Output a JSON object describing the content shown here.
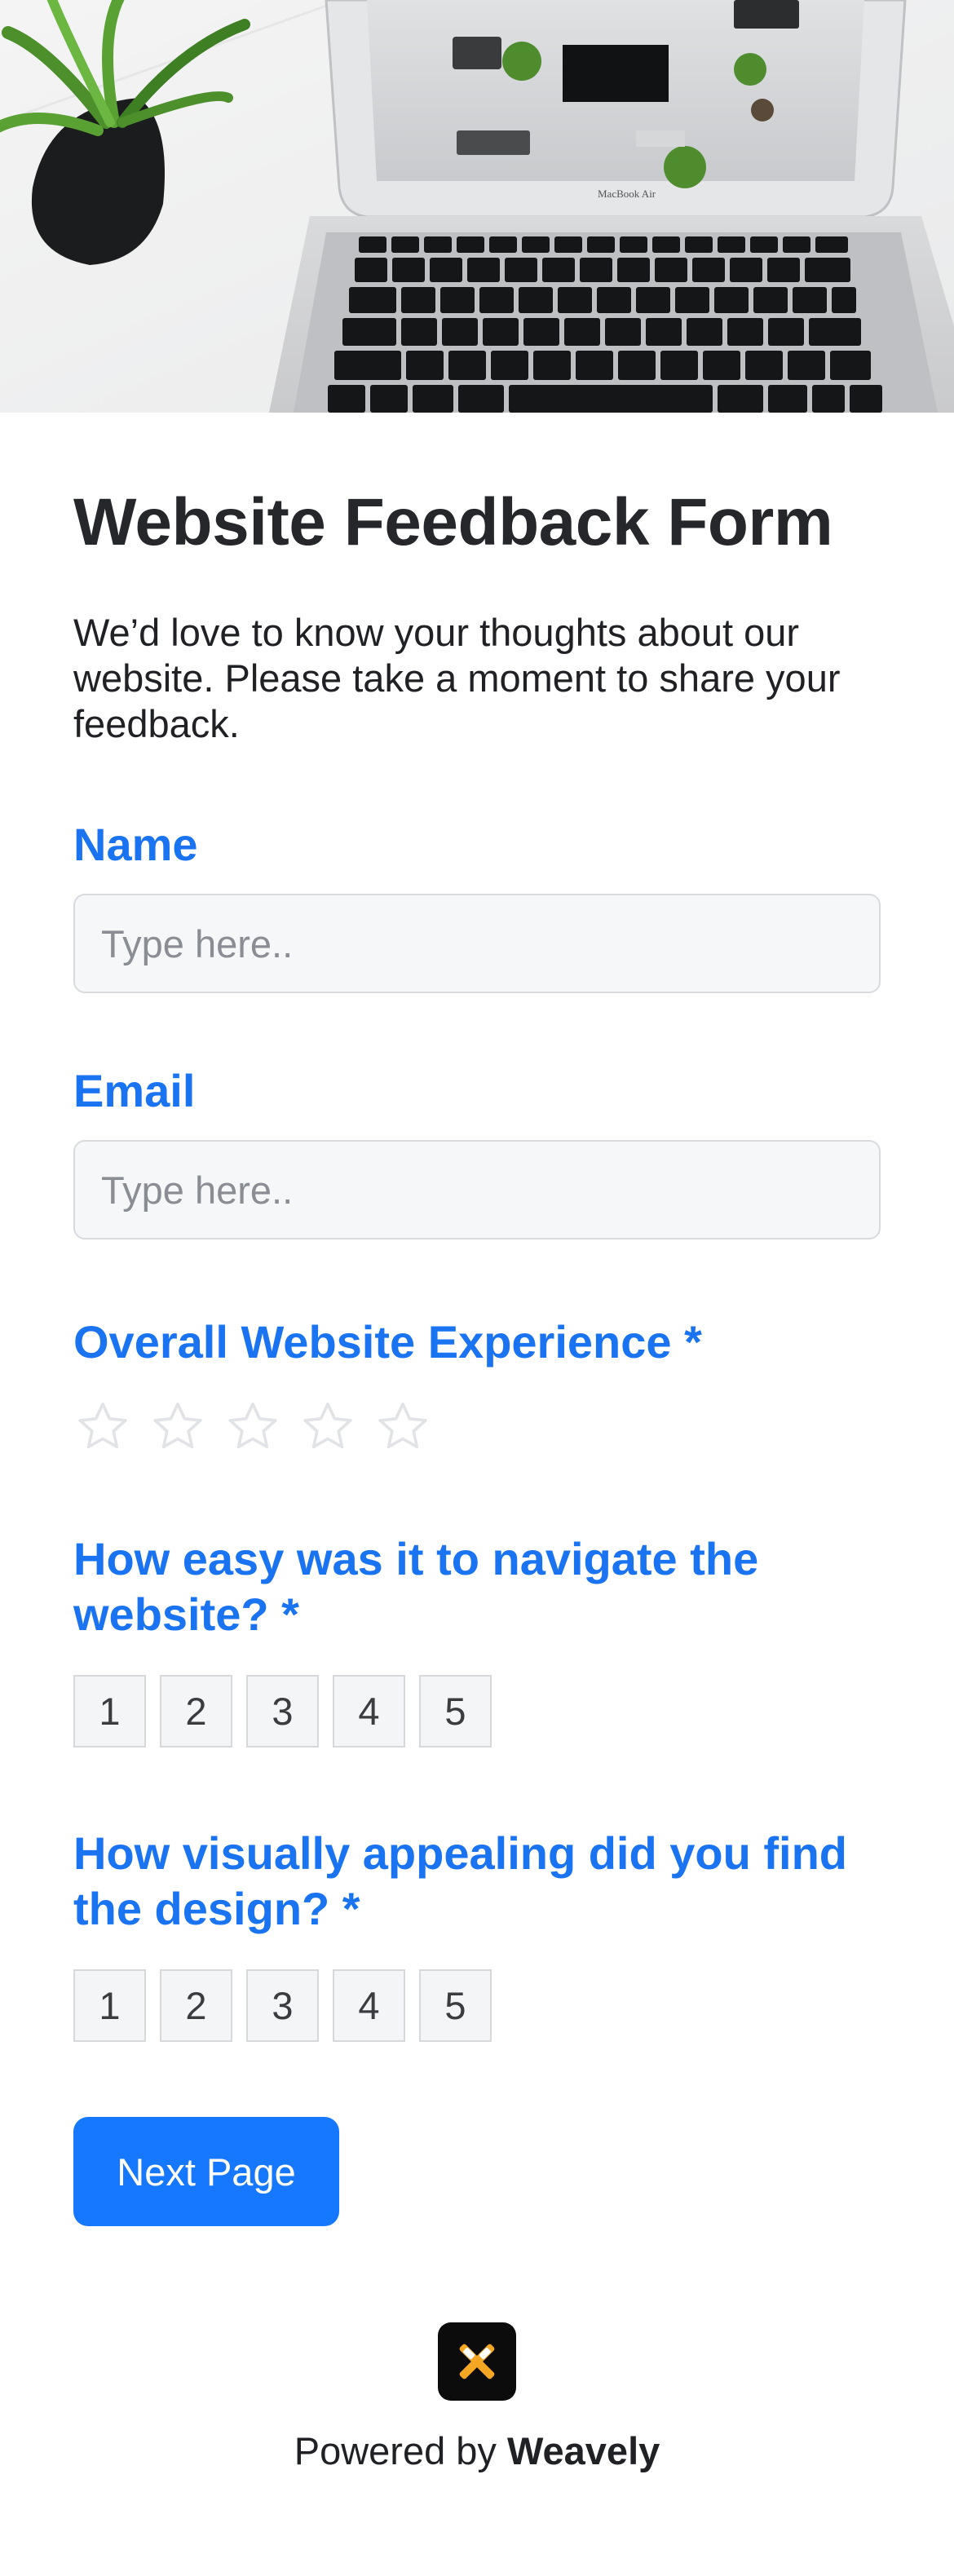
{
  "hero": {
    "image_alt": "Laptop on a white desk with a potted plant",
    "laptop_brand": "MacBook Air"
  },
  "form": {
    "title": "Website Feedback Form",
    "description": "We’d love to know your thoughts about our website. Please take a moment to share your feedback."
  },
  "fields": {
    "name": {
      "label": "Name",
      "placeholder": "Type here..",
      "value": ""
    },
    "email": {
      "label": "Email",
      "placeholder": "Type here..",
      "value": ""
    },
    "experience": {
      "label": "Overall Website Experience *",
      "rating": 0,
      "max_rating": 5,
      "icon": "star-icon"
    },
    "navigate": {
      "label": "How easy was it to navigate the website? *",
      "options": [
        "1",
        "2",
        "3",
        "4",
        "5"
      ]
    },
    "design": {
      "label": "How visually appealing did you find the design? *",
      "options": [
        "1",
        "2",
        "3",
        "4",
        "5"
      ]
    }
  },
  "buttons": {
    "next_label": "Next Page"
  },
  "footer": {
    "powered_prefix": "Powered by",
    "brand": "Weavely",
    "logo_icon": "weavely-logo-icon"
  },
  "colors": {
    "accent": "#1a73f0",
    "button": "#1677ff",
    "input_bg": "#f6f7f9",
    "star_outline": "#e1e3e6"
  }
}
